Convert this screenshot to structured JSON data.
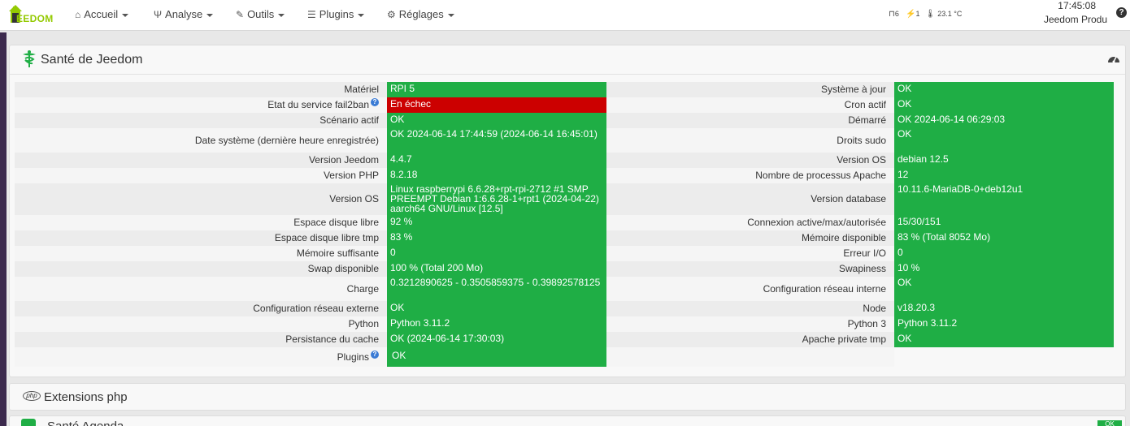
{
  "brand": {
    "logo_text": "EEDOM"
  },
  "nav": {
    "items": [
      {
        "label": "Accueil",
        "icon": "home-icon"
      },
      {
        "label": "Analyse",
        "icon": "stethoscope-icon"
      },
      {
        "label": "Outils",
        "icon": "wrench-icon"
      },
      {
        "label": "Plugins",
        "icon": "list-icon"
      },
      {
        "label": "Réglages",
        "icon": "gear-icon"
      }
    ],
    "status": {
      "doors": "6",
      "plugs": "1",
      "temperature": "23.1 °C"
    },
    "time": "17:45:08",
    "profile": "Jeedom Produ",
    "help": "?"
  },
  "health": {
    "title": "Santé de Jeedom",
    "left": [
      {
        "label": "Matériel",
        "value": "RPI 5",
        "status": "ok"
      },
      {
        "label": "Etat du service fail2ban",
        "value": "En échec",
        "status": "ko",
        "help": true
      },
      {
        "label": "Scénario actif",
        "value": "OK",
        "status": "ok"
      },
      {
        "label": "Date système (dernière heure enregistrée)",
        "value": "OK 2024-06-14 17:44:59 (2024-06-14 16:45:01)",
        "status": "ok"
      },
      {
        "label": "Version Jeedom",
        "value": "4.4.7",
        "status": "ok"
      },
      {
        "label": "Version PHP",
        "value": "8.2.18",
        "status": "ok"
      },
      {
        "label": "Version OS",
        "value": "Linux raspberrypi 6.6.28+rpt-rpi-2712 #1 SMP PREEMPT Debian 1:6.6.28-1+rpt1 (2024-04-22) aarch64 GNU/Linux [12.5]",
        "status": "ok"
      },
      {
        "label": "Espace disque libre",
        "value": "92 %",
        "status": "ok"
      },
      {
        "label": "Espace disque libre tmp",
        "value": "83 %",
        "status": "ok"
      },
      {
        "label": "Mémoire suffisante",
        "value": "0",
        "status": "ok"
      },
      {
        "label": "Swap disponible",
        "value": "100 % (Total 200 Mo)",
        "status": "ok"
      },
      {
        "label": "Charge",
        "value": "0.3212890625 - 0.3505859375 - 0.39892578125",
        "status": "ok"
      },
      {
        "label": "Configuration réseau externe",
        "value": "OK",
        "status": "ok"
      },
      {
        "label": "Python",
        "value": "Python 3.11.2",
        "status": "ok"
      },
      {
        "label": "Persistance du cache",
        "value": "OK (2024-06-14 17:30:03)",
        "status": "ok"
      },
      {
        "label": "Plugins",
        "value": "OK",
        "status": "ok",
        "help": true
      }
    ],
    "right": [
      {
        "label": "Système à jour",
        "value": "OK",
        "status": "ok"
      },
      {
        "label": "Cron actif",
        "value": "OK",
        "status": "ok"
      },
      {
        "label": "Démarré",
        "value": "OK 2024-06-14 06:29:03",
        "status": "ok"
      },
      {
        "label": "Droits sudo",
        "value": "OK",
        "status": "ok"
      },
      {
        "label": "Version OS",
        "value": "debian 12.5",
        "status": "ok"
      },
      {
        "label": "Nombre de processus Apache",
        "value": "12",
        "status": "ok"
      },
      {
        "label": "Version database",
        "value": "10.11.6-MariaDB-0+deb12u1",
        "status": "ok"
      },
      {
        "label": "Connexion active/max/autorisée",
        "value": "15/30/151",
        "status": "ok"
      },
      {
        "label": "Mémoire disponible",
        "value": "83 % (Total 8052 Mo)",
        "status": "ok"
      },
      {
        "label": "Erreur I/O",
        "value": "0",
        "status": "ok"
      },
      {
        "label": "Swapiness",
        "value": "10 %",
        "status": "ok"
      },
      {
        "label": "Configuration réseau interne",
        "value": "OK",
        "status": "ok"
      },
      {
        "label": "Node",
        "value": "v18.20.3",
        "status": "ok"
      },
      {
        "label": "Python 3",
        "value": "Python 3.11.2",
        "status": "ok"
      },
      {
        "label": "Apache private tmp",
        "value": "OK",
        "status": "ok"
      },
      {
        "label": "",
        "value": "",
        "status": "empty"
      }
    ]
  },
  "extensions": {
    "title": "Extensions php",
    "icon_text": "php"
  },
  "agenda": {
    "title": "Santé Agenda",
    "badge": "OK"
  },
  "colors": {
    "ok": "#1fae45",
    "ko": "#cc0000",
    "brand": "#94ca02"
  }
}
